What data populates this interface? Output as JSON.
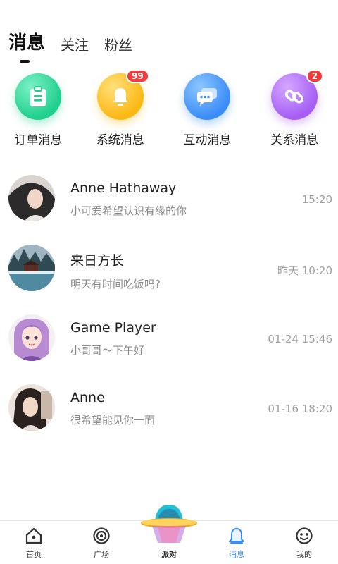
{
  "header": {
    "tabs": [
      {
        "label": "消息",
        "active": true
      },
      {
        "label": "关注",
        "active": false
      },
      {
        "label": "粉丝",
        "active": false
      }
    ]
  },
  "categories": [
    {
      "label": "订单消息",
      "icon": "clipboard-icon",
      "color": "#1fcf8c",
      "badge": ""
    },
    {
      "label": "系统消息",
      "icon": "bell-icon",
      "color": "#fbb812",
      "badge": "99"
    },
    {
      "label": "互动消息",
      "icon": "chat-bubble-icon",
      "color": "#3a8cf7",
      "badge": ""
    },
    {
      "label": "关系消息",
      "icon": "link-icon",
      "color": "#a55df4",
      "badge": "2"
    }
  ],
  "messages": [
    {
      "name": "Anne Hathaway",
      "preview": "小可爱希望认识有缘的你",
      "time": "15:20"
    },
    {
      "name": "来日方长",
      "preview": "明天有时间吃饭吗?",
      "time": "昨天 10:20"
    },
    {
      "name": "Game Player",
      "preview": "小哥哥～下午好",
      "time": "01-24 15:46"
    },
    {
      "name": "Anne",
      "preview": "很希望能见你一面",
      "time": "01-16 18:20"
    }
  ],
  "nav": {
    "items": [
      {
        "label": "首页",
        "icon": "home-icon",
        "active": false
      },
      {
        "label": "广场",
        "icon": "target-icon",
        "active": false
      },
      {
        "label": "派对",
        "icon": "ufo-icon",
        "active": false
      },
      {
        "label": "消息",
        "icon": "bell-icon",
        "active": true
      },
      {
        "label": "我的",
        "icon": "smiley-icon",
        "active": false
      }
    ]
  },
  "colors": {
    "accent": "#3a8cf7",
    "badge": "#f23b3b"
  }
}
